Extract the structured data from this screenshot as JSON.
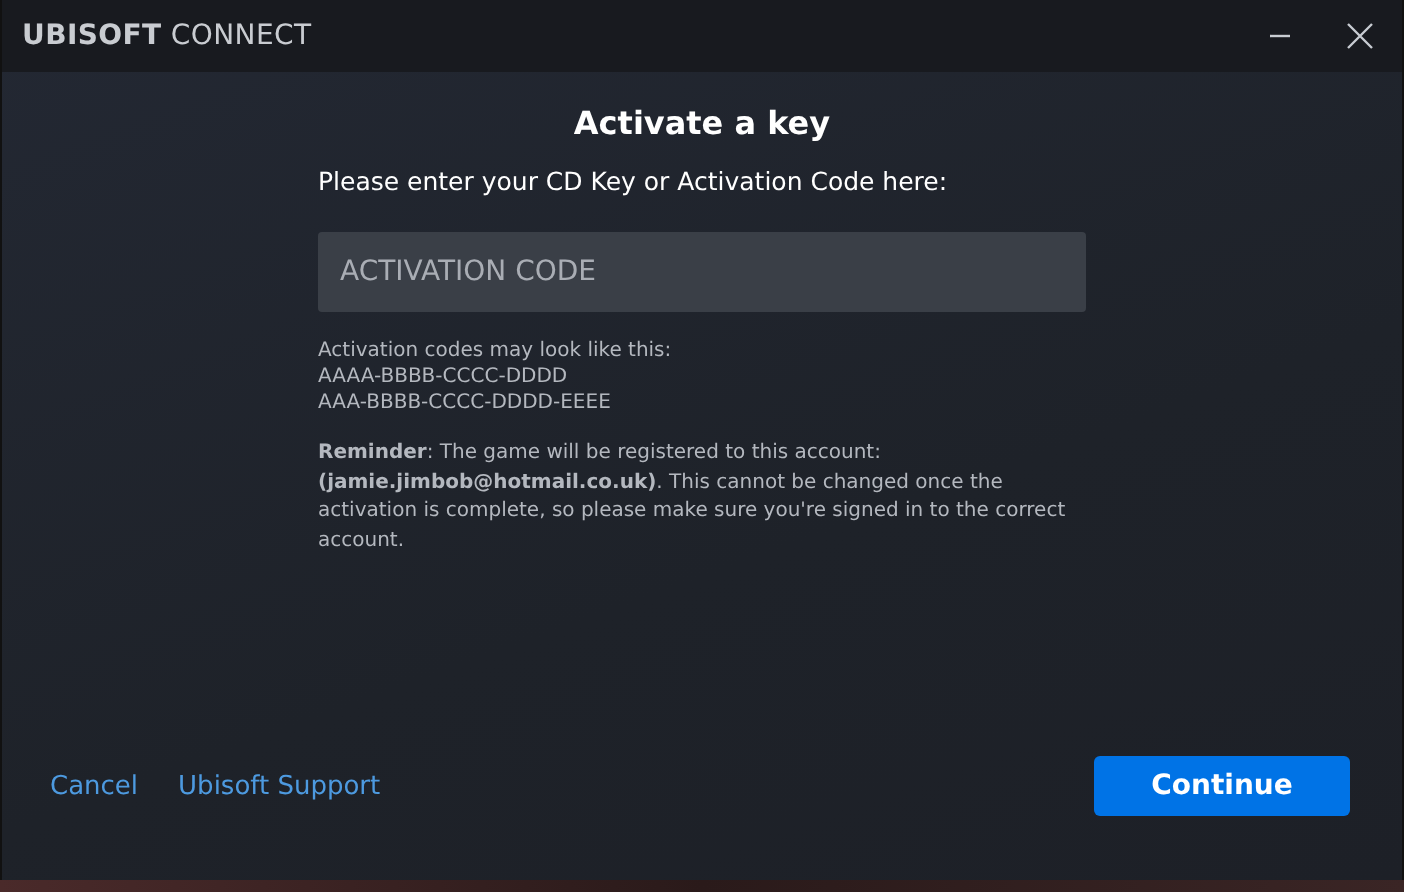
{
  "window": {
    "title": "**UBISOFT** CONNECT"
  },
  "dialog": {
    "heading": "Activate a key",
    "prompt": "Please enter your CD Key or Activation Code here:",
    "code_field": {
      "placeholder": "ACTIVATION CODE"
    },
    "format_lines": [
      "Activation codes may look like this:",
      "AAAA-BBBB-CCCC-DDDD",
      "AAA-BBBB-CCCC-DDDD-EEEE"
    ],
    "reminder": "**Reminder**: The game will be registered to this account: **(jamie.jimbob@hotmail.co.uk)**. This cannot be changed once the activation is complete, so please make sure you're signed in to the correct account."
  },
  "footer": {
    "links": [
      "Cancel",
      "Ubisoft Support"
    ],
    "primary_button": "Continue"
  }
}
